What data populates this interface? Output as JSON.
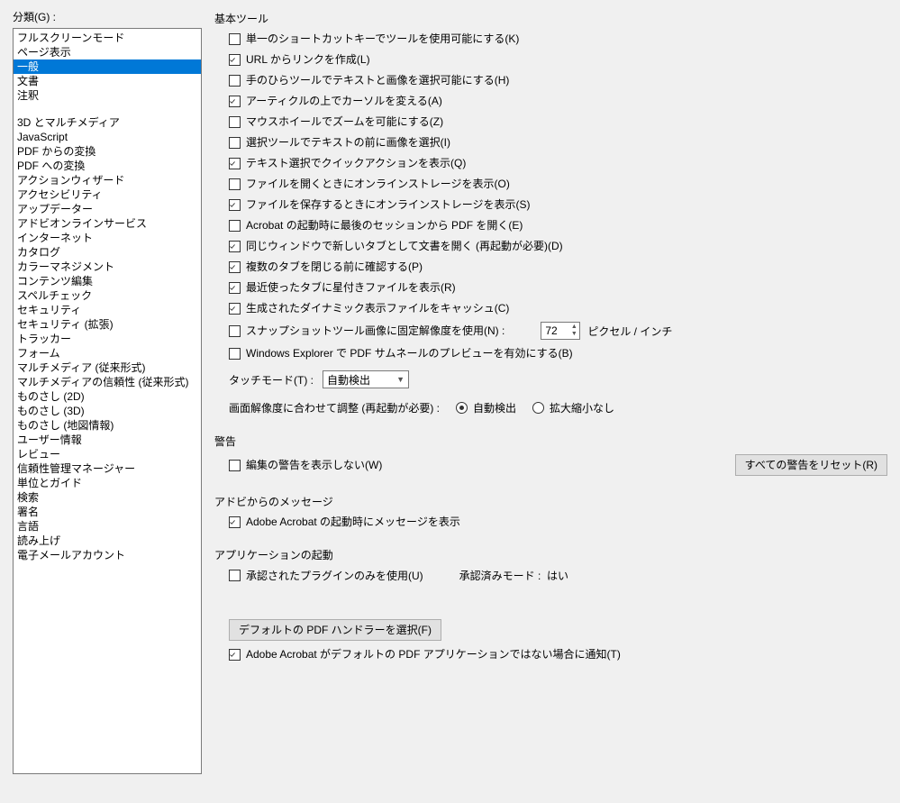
{
  "left": {
    "label": "分類(G) :",
    "items_top": [
      "フルスクリーンモード",
      "ページ表示",
      "一般",
      "文書",
      "注釈"
    ],
    "selected": "一般",
    "items_bottom": [
      "3D とマルチメディア",
      "JavaScript",
      "PDF からの変換",
      "PDF への変換",
      "アクションウィザード",
      "アクセシビリティ",
      "アップデーター",
      "アドビオンラインサービス",
      "インターネット",
      "カタログ",
      "カラーマネジメント",
      "コンテンツ編集",
      "スペルチェック",
      "セキュリティ",
      "セキュリティ (拡張)",
      "トラッカー",
      "フォーム",
      "マルチメディア (従来形式)",
      "マルチメディアの信頼性 (従来形式)",
      "ものさし (2D)",
      "ものさし (3D)",
      "ものさし (地図情報)",
      "ユーザー情報",
      "レビュー",
      "信頼性管理マネージャー",
      "単位とガイド",
      "検索",
      "署名",
      "言語",
      "読み上げ",
      "電子メールアカウント"
    ]
  },
  "basic": {
    "title": "基本ツール",
    "checks": [
      {
        "label": "単一のショートカットキーでツールを使用可能にする(K)",
        "checked": false
      },
      {
        "label": "URL からリンクを作成(L)",
        "checked": true
      },
      {
        "label": "手のひらツールでテキストと画像を選択可能にする(H)",
        "checked": false
      },
      {
        "label": "アーティクルの上でカーソルを変える(A)",
        "checked": true
      },
      {
        "label": "マウスホイールでズームを可能にする(Z)",
        "checked": false
      },
      {
        "label": "選択ツールでテキストの前に画像を選択(I)",
        "checked": false
      },
      {
        "label": "テキスト選択でクイックアクションを表示(Q)",
        "checked": true
      },
      {
        "label": "ファイルを開くときにオンラインストレージを表示(O)",
        "checked": false
      },
      {
        "label": "ファイルを保存するときにオンラインストレージを表示(S)",
        "checked": true
      },
      {
        "label": "Acrobat の起動時に最後のセッションから PDF を開く(E)",
        "checked": false
      },
      {
        "label": "同じウィンドウで新しいタブとして文書を開く (再起動が必要)(D)",
        "checked": true
      },
      {
        "label": "複数のタブを閉じる前に確認する(P)",
        "checked": true
      },
      {
        "label": "最近使ったタブに星付きファイルを表示(R)",
        "checked": true
      },
      {
        "label": "生成されたダイナミック表示ファイルをキャッシュ(C)",
        "checked": true
      }
    ],
    "snapshot": {
      "label": "スナップショットツール画像に固定解像度を使用(N) :",
      "checked": false,
      "value": "72",
      "unit": "ピクセル / インチ"
    },
    "thumb": {
      "label": "Windows Explorer で PDF サムネールのプレビューを有効にする(B)",
      "checked": false
    },
    "touch": {
      "label": "タッチモード(T) :",
      "value": "自動検出"
    },
    "resolution": {
      "label": "画面解像度に合わせて調整 (再起動が必要) :",
      "opt1": "自動検出",
      "opt2": "拡大縮小なし",
      "selected": "自動検出"
    }
  },
  "warn": {
    "title": "警告",
    "check": {
      "label": "編集の警告を表示しない(W)",
      "checked": false
    },
    "reset": "すべての警告をリセット(R)"
  },
  "adobe_msg": {
    "title": "アドビからのメッセージ",
    "check": {
      "label": "Adobe Acrobat の起動時にメッセージを表示",
      "checked": true
    }
  },
  "startup": {
    "title": "アプリケーションの起動",
    "plugin": {
      "label": "承認されたプラグインのみを使用(U)",
      "checked": false
    },
    "mode_label": "承認済みモード :",
    "mode_value": "はい",
    "button": "デフォルトの PDF ハンドラーを選択(F)",
    "notify": {
      "label": "Adobe Acrobat がデフォルトの PDF アプリケーションではない場合に通知(T)",
      "checked": true
    }
  }
}
